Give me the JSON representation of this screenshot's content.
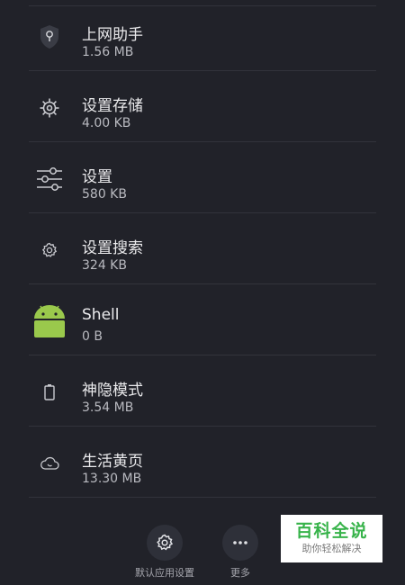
{
  "apps": [
    {
      "name": "上网助手",
      "size": "1.56 MB",
      "icon": "network-assistant-icon"
    },
    {
      "name": "设置存储",
      "size": "4.00 KB",
      "icon": "settings-storage-gear-icon"
    },
    {
      "name": "设置",
      "size": "580 KB",
      "icon": "settings-sliders-icon"
    },
    {
      "name": "设置搜索",
      "size": "324 KB",
      "icon": "settings-search-gear-icon"
    },
    {
      "name": "Shell",
      "size": "0 B",
      "icon": "android-icon"
    },
    {
      "name": "神隐模式",
      "size": "3.54 MB",
      "icon": "battery-icon"
    },
    {
      "name": "生活黄页",
      "size": "13.30 MB",
      "icon": "cloud-phone-icon"
    }
  ],
  "bottom_actions": {
    "default_apps_label": "默认应用设置",
    "more_label": "更多"
  },
  "watermark": {
    "title": "百科全说",
    "subtitle": "助你轻松解决"
  },
  "colors": {
    "background": "#212229",
    "android_green": "#9ac94c",
    "watermark_green": "#37b34a"
  }
}
